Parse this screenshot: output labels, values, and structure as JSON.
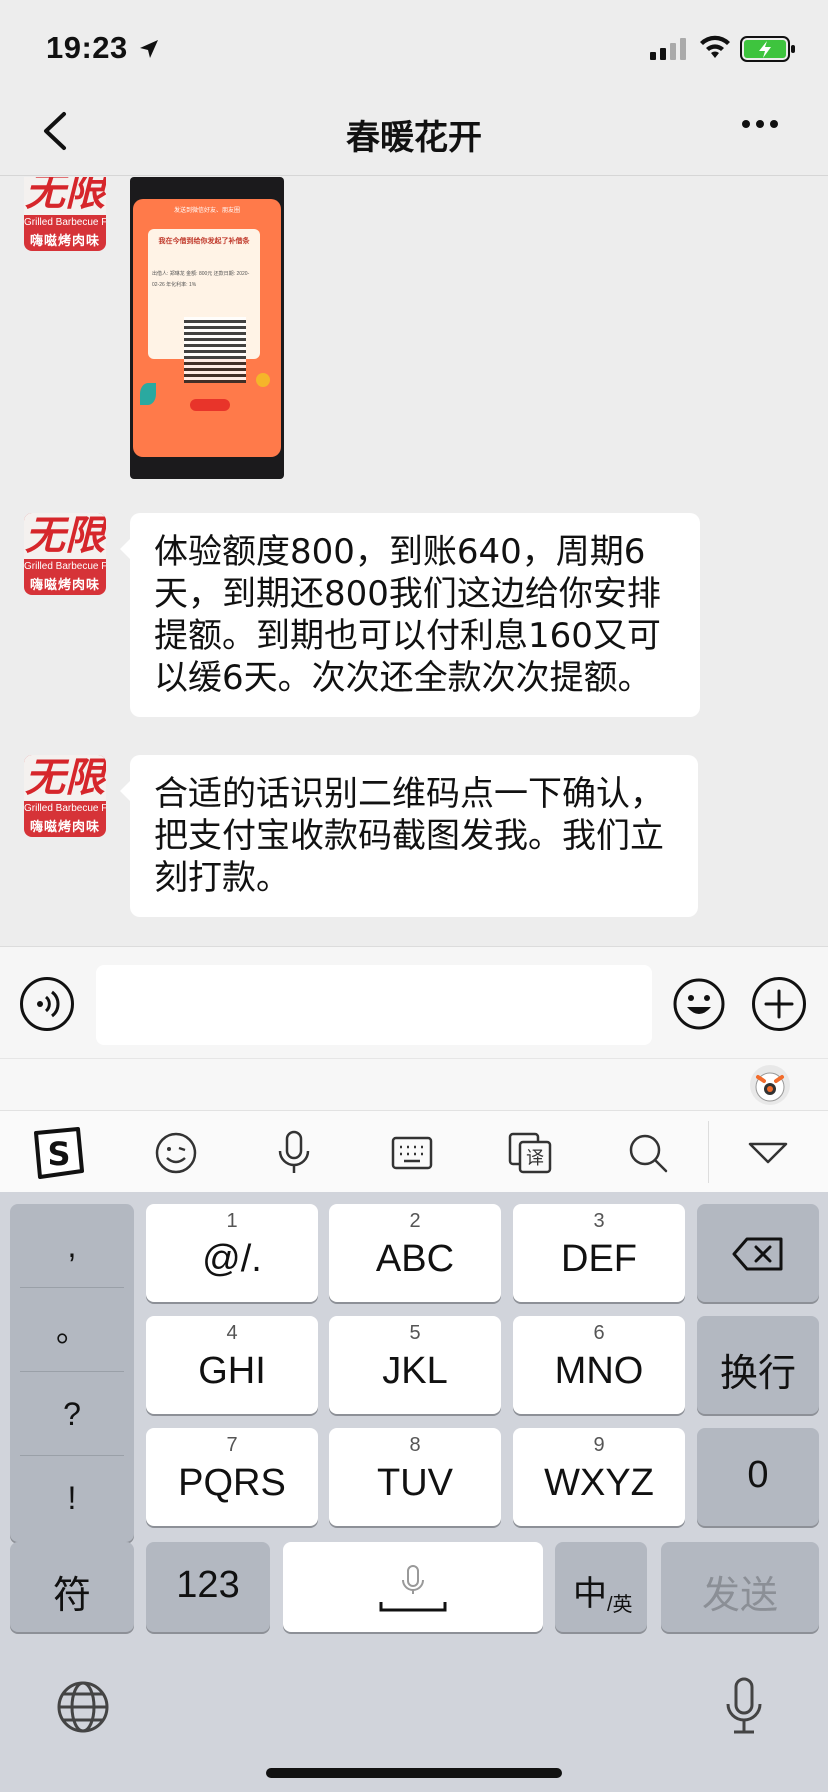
{
  "status_bar": {
    "time": "19:23"
  },
  "nav": {
    "title": "春暖花开"
  },
  "messages": [
    {
      "type": "image",
      "image_text": {
        "line1": "发送到微信好友、朋友圈",
        "line2": "我在今借到给你发起了补借条",
        "line3": "出借人: 郑琳龙  金额: 800元  还款日期: 2020-02-26  年化利率: 1%"
      }
    },
    {
      "type": "text",
      "text": "体验额度800，到账640，周期6天，到期还800我们这边给你安排提额。到期也可以付利息160又可以缓6天。次次还全款次次提额。"
    },
    {
      "type": "text",
      "text": "合适的话识别二维码点一下确认，把支付宝收款码截图发我。我们立刻打款。"
    }
  ],
  "avatar": {
    "top": "无限",
    "mid": "Grilled Barbecue Flavor",
    "bot": "嗨嗞烤肉味"
  },
  "input": {
    "value": ""
  },
  "toolbar": {
    "icons": [
      "sogou-logo-icon",
      "emoji-icon",
      "microphone-icon",
      "keyboard-icon",
      "translate-icon",
      "search-icon",
      "collapse-keyboard-icon"
    ]
  },
  "keyboard": {
    "punct": [
      ",",
      "。",
      "?",
      "!"
    ],
    "keys": [
      {
        "num": "1",
        "label": "@/."
      },
      {
        "num": "2",
        "label": "ABC"
      },
      {
        "num": "3",
        "label": "DEF"
      },
      {
        "num": "4",
        "label": "GHI"
      },
      {
        "num": "5",
        "label": "JKL"
      },
      {
        "num": "6",
        "label": "MNO"
      },
      {
        "num": "7",
        "label": "PQRS"
      },
      {
        "num": "8",
        "label": "TUV"
      },
      {
        "num": "9",
        "label": "WXYZ"
      }
    ],
    "enter": "换行",
    "zero": "0",
    "symbols": "符",
    "numbers": "123",
    "lang_main": "中",
    "lang_sub": "/英",
    "send": "发送"
  }
}
